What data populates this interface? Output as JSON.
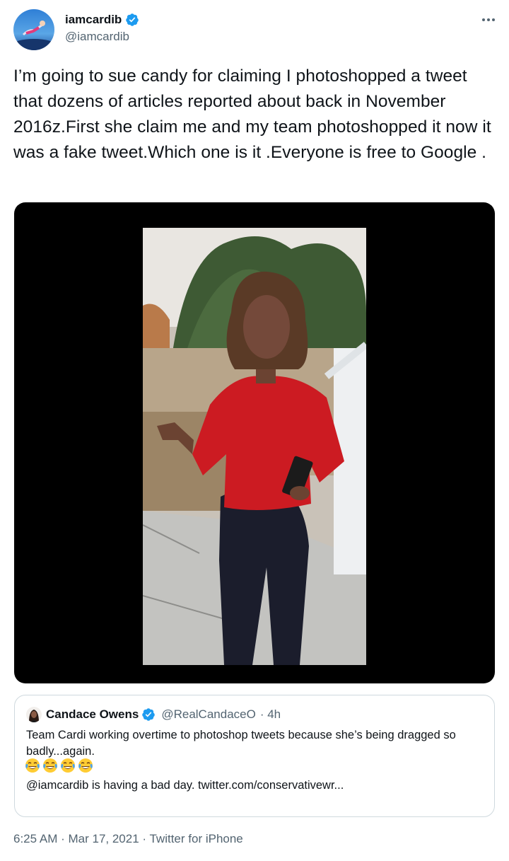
{
  "author": {
    "name": "iamcardib",
    "handle": "@iamcardib",
    "verified": true,
    "avatar_icon": "avatar-image"
  },
  "tweet": {
    "text": "I’m going to sue candy for claiming I photoshopped a tweet that dozens of articles reported about back in November 2016z.First she claim me and my team photoshopped it now it was a fake tweet.Which one is it .Everyone is free to Google ."
  },
  "media": {
    "type": "video",
    "description_icon": "video-thumbnail"
  },
  "quoted_tweet": {
    "name": "Candace Owens",
    "handle": "@RealCandaceO",
    "time": "· 4h",
    "verified": true,
    "text": "Team Cardi working overtime to photoshop tweets because she’s being dragged so badly...again.",
    "emoji_count": 4,
    "link_line": "@iamcardib is having a bad day. twitter.com/conservativewr..."
  },
  "footer": {
    "time": "6:25 AM",
    "separator1": " · ",
    "date": "Mar 17, 2021",
    "separator2": " · ",
    "source": "Twitter for iPhone"
  },
  "colors": {
    "verified": "#1d9bf0",
    "secondary_text": "#536471",
    "border": "#cfd9de"
  }
}
